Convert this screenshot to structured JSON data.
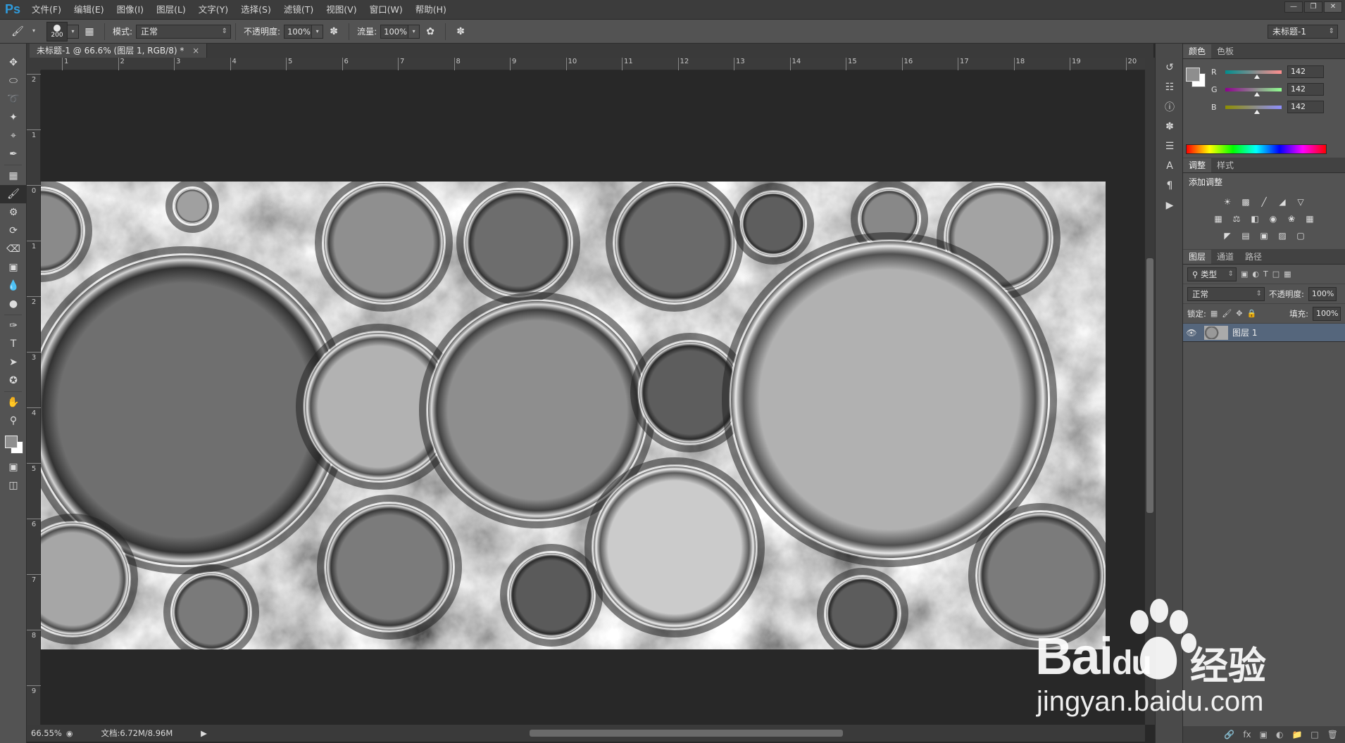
{
  "app": {
    "logo": "Ps"
  },
  "menu": [
    "文件(F)",
    "编辑(E)",
    "图像(I)",
    "图层(L)",
    "文字(Y)",
    "选择(S)",
    "滤镜(T)",
    "视图(V)",
    "窗口(W)",
    "帮助(H)"
  ],
  "window_controls": [
    "minimize-icon",
    "restore-icon",
    "close-icon"
  ],
  "options": {
    "brush_size": "200",
    "mode_label": "模式:",
    "mode_value": "正常",
    "opacity_label": "不透明度:",
    "opacity_value": "100%",
    "flow_label": "流量:",
    "flow_value": "100%",
    "document_switch": "未标题-1"
  },
  "document": {
    "tab_title": "未标题-1 @ 66.6% (图层 1, RGB/8) *",
    "close": "×"
  },
  "ruler": {
    "top_labels": [
      "1",
      "2",
      "3",
      "4",
      "5",
      "6",
      "7",
      "8",
      "9",
      "10",
      "11",
      "12",
      "13",
      "14",
      "15",
      "16",
      "17",
      "18",
      "19",
      "20"
    ],
    "left_labels": [
      "2",
      "1",
      "0",
      "1",
      "2",
      "3",
      "4",
      "5",
      "6",
      "7",
      "8",
      "9"
    ]
  },
  "status": {
    "zoom": "66.55%",
    "doc_size": "文档:6.72M/8.96M"
  },
  "color_panel": {
    "tabs": [
      "颜色",
      "色板"
    ],
    "foreground": "#8e8e8e",
    "background": "#ffffff",
    "channels": [
      {
        "label": "R",
        "value": "142",
        "gradient": "linear-gradient(to right,#008e8e,#ff8e8e)"
      },
      {
        "label": "G",
        "value": "142",
        "gradient": "linear-gradient(to right,#8e008e,#8eff8e)"
      },
      {
        "label": "B",
        "value": "142",
        "gradient": "linear-gradient(to right,#8e8e00,#8e8eff)"
      }
    ]
  },
  "adjustments_panel": {
    "tabs": [
      "调整",
      "样式"
    ],
    "title": "添加调整"
  },
  "layers_panel": {
    "tabs": [
      "图层",
      "通道",
      "路径"
    ],
    "filter_kind": "类型",
    "blend_mode": "正常",
    "opacity_label": "不透明度:",
    "opacity_value": "100%",
    "lock_label": "锁定:",
    "fill_label": "填充:",
    "fill_value": "100%",
    "layers": [
      {
        "name": "图层 1",
        "visible": true
      }
    ]
  },
  "watermark": {
    "brand": "Bai",
    "brand2": "du",
    "service": "经验",
    "url": "jingyan.baidu.com"
  }
}
